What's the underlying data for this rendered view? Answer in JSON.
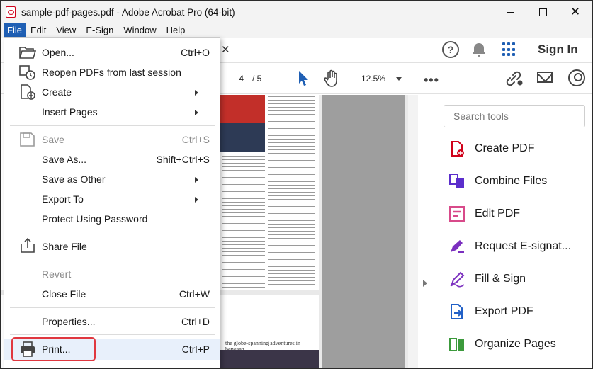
{
  "window": {
    "title": "sample-pdf-pages.pdf - Adobe Acrobat Pro (64-bit)",
    "minimize": "—",
    "maximize": "□",
    "close": "✕"
  },
  "menubar": {
    "items": [
      "File",
      "Edit",
      "View",
      "E-Sign",
      "Window",
      "Help"
    ]
  },
  "tabbar": {
    "close_tab": "✕",
    "help": "?",
    "signin": "Sign In"
  },
  "toolbar": {
    "current_page": "4",
    "total_pages": "/ 5",
    "zoom": "12.5%",
    "more": "•••"
  },
  "document": {
    "caption": "the globe-spanning adventures in between."
  },
  "right_panel": {
    "search_placeholder": "Search tools",
    "tools": [
      {
        "label": "Create PDF",
        "color": "#d0021b"
      },
      {
        "label": "Combine Files",
        "color": "#5b2ecc"
      },
      {
        "label": "Edit PDF",
        "color": "#d84a8a"
      },
      {
        "label": "Request E-signat...",
        "color": "#7b2fbf"
      },
      {
        "label": "Fill & Sign",
        "color": "#7b2fbf"
      },
      {
        "label": "Export PDF",
        "color": "#2160c7"
      },
      {
        "label": "Organize Pages",
        "color": "#3c9a3c"
      }
    ]
  },
  "file_menu": {
    "open": {
      "label": "Open...",
      "shortcut": "Ctrl+O"
    },
    "reopen": {
      "label": "Reopen PDFs from last session"
    },
    "create": {
      "label": "Create"
    },
    "insert_pages": {
      "label": "Insert Pages"
    },
    "save": {
      "label": "Save",
      "shortcut": "Ctrl+S"
    },
    "save_as": {
      "label": "Save As...",
      "shortcut": "Shift+Ctrl+S"
    },
    "save_as_other": {
      "label": "Save as Other"
    },
    "export_to": {
      "label": "Export To"
    },
    "protect": {
      "label": "Protect Using Password"
    },
    "share": {
      "label": "Share File"
    },
    "revert": {
      "label": "Revert"
    },
    "close_file": {
      "label": "Close File",
      "shortcut": "Ctrl+W"
    },
    "properties": {
      "label": "Properties...",
      "shortcut": "Ctrl+D"
    },
    "print": {
      "label": "Print...",
      "shortcut": "Ctrl+P"
    }
  }
}
